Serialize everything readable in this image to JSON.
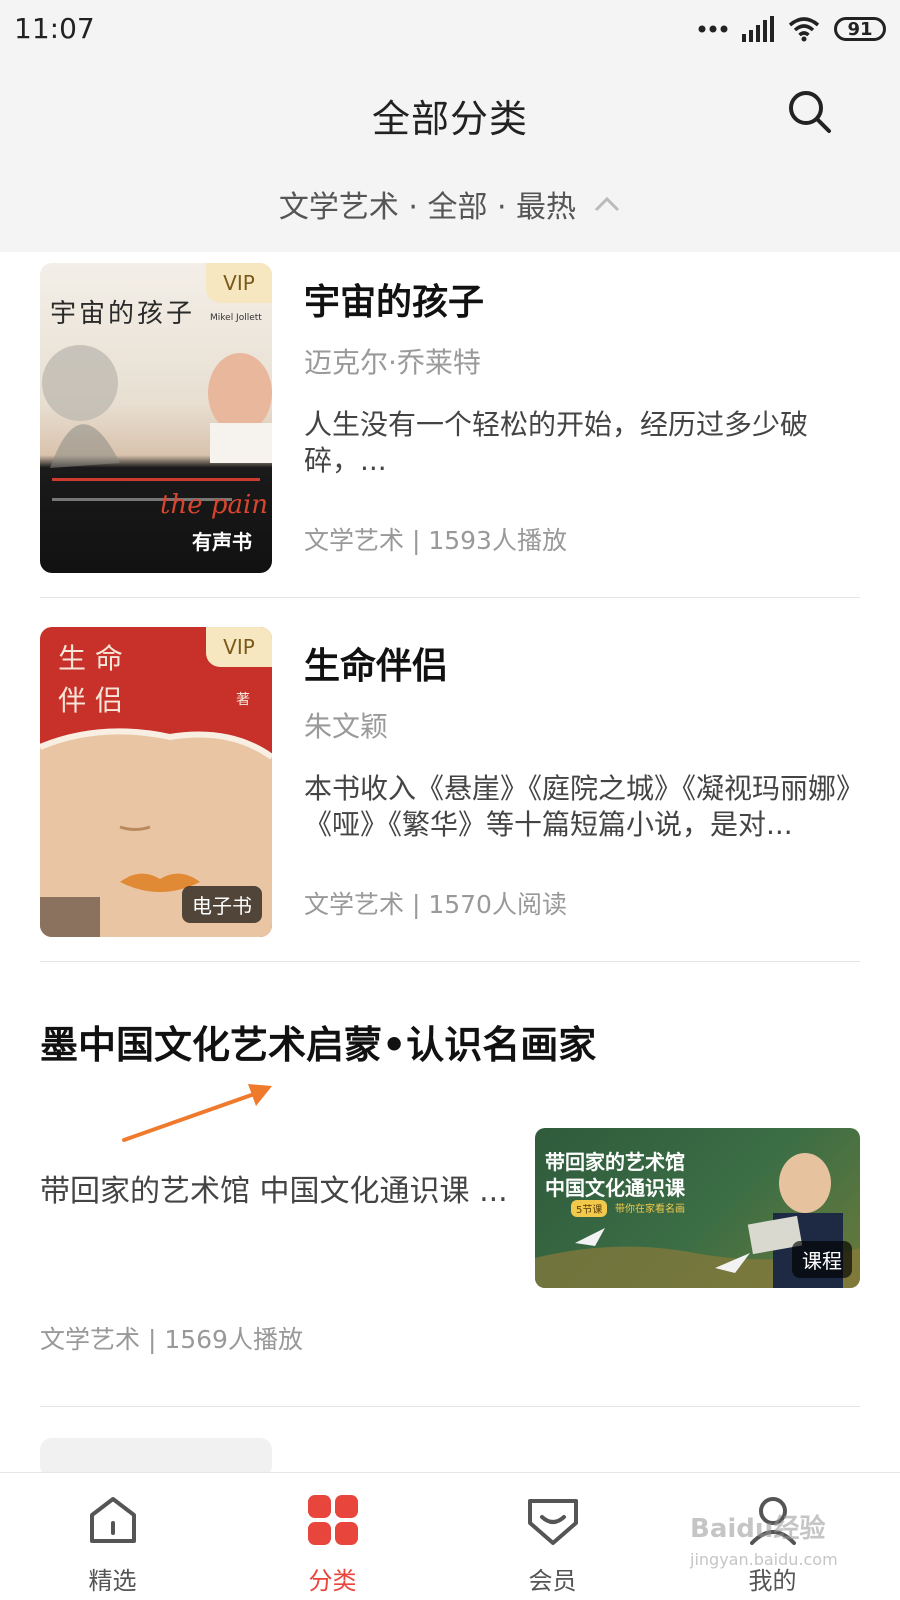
{
  "status_bar": {
    "time": "11:07",
    "battery": "91"
  },
  "header": {
    "title": "全部分类"
  },
  "filter": {
    "text": "文学艺术 · 全部 · 最热"
  },
  "items": [
    {
      "title": "宇宙的孩子",
      "author": "迈克尔·乔莱特",
      "description": "人生没有一个轻松的开始，经历过多少破碎，...",
      "meta": "文学艺术 | 1593人播放",
      "vip": "VIP",
      "type_badge": "有声书",
      "cover_text": "宇宙的孩子",
      "cover_author_en": "Mikel Jollett"
    },
    {
      "title": "生命伴侣",
      "author": "朱文颖",
      "description": "本书收入《悬崖》《庭院之城》《凝视玛丽娜》《哑》《繁华》等十篇短篇小说，是对...",
      "meta": "文学艺术 | 1570人阅读",
      "vip": "VIP",
      "type_badge": "电子书",
      "cover_text_1": "生 命",
      "cover_text_2": "伴 侣",
      "cover_author": "著"
    }
  ],
  "course": {
    "title": "墨中国文化艺术启蒙•认识名画家",
    "description": "带回家的艺术馆 中国文化通识课 ...",
    "meta": "文学艺术 | 1569人播放",
    "type_badge": "课程",
    "cover_line1": "带回家的艺术馆",
    "cover_line2": "中国文化通识课",
    "cover_tag": "5节课",
    "cover_tag2": "带你在家看名画"
  },
  "tabs": [
    {
      "label": "精选",
      "icon": "home-icon"
    },
    {
      "label": "分类",
      "icon": "category-icon"
    },
    {
      "label": "会员",
      "icon": "member-icon"
    },
    {
      "label": "我的",
      "icon": "profile-icon"
    }
  ],
  "watermark": {
    "main": "Baidu经验",
    "sub": "jingyan.baidu.com"
  },
  "colors": {
    "accent": "#e8453c",
    "vip_bg": "#f6e7c0",
    "arrow": "#f07a2c"
  }
}
